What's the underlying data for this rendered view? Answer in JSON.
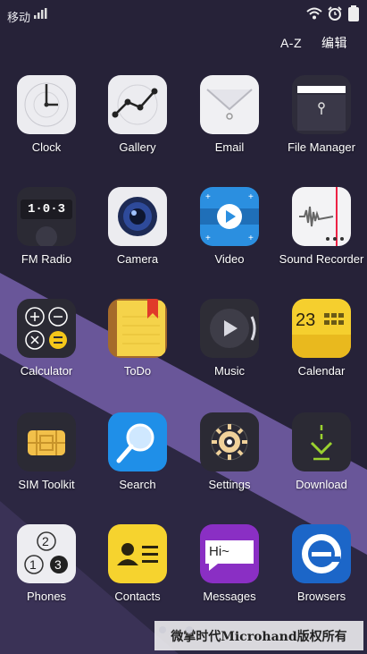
{
  "status_bar": {
    "carrier": "移动",
    "icons": [
      "wifi-icon",
      "alarm-icon",
      "battery-icon"
    ]
  },
  "top_actions": {
    "sort_label": "A-Z",
    "edit_label": "编辑"
  },
  "apps": [
    {
      "label": "Clock",
      "icon": "clock-icon"
    },
    {
      "label": "Gallery",
      "icon": "gallery-icon"
    },
    {
      "label": "Email",
      "icon": "email-icon"
    },
    {
      "label": "File Manager",
      "icon": "file-manager-icon"
    },
    {
      "label": "FM Radio",
      "icon": "fm-radio-icon",
      "display": "1·0·3"
    },
    {
      "label": "Camera",
      "icon": "camera-icon"
    },
    {
      "label": "Video",
      "icon": "video-icon"
    },
    {
      "label": "Sound Recorder",
      "icon": "sound-recorder-icon"
    },
    {
      "label": "Calculator",
      "icon": "calculator-icon"
    },
    {
      "label": "ToDo",
      "icon": "todo-icon"
    },
    {
      "label": "Music",
      "icon": "music-icon"
    },
    {
      "label": "Calendar",
      "icon": "calendar-icon",
      "display": "23"
    },
    {
      "label": "SIM Toolkit",
      "icon": "sim-toolkit-icon"
    },
    {
      "label": "Search",
      "icon": "search-icon"
    },
    {
      "label": "Settings",
      "icon": "settings-icon"
    },
    {
      "label": "Download",
      "icon": "download-icon"
    },
    {
      "label": "Phones",
      "icon": "phones-icon",
      "display": [
        "2",
        "1",
        "3"
      ]
    },
    {
      "label": "Contacts",
      "icon": "contacts-icon"
    },
    {
      "label": "Messages",
      "icon": "messages-icon",
      "display": "Hi~"
    },
    {
      "label": "Browsers",
      "icon": "browser-icon"
    }
  ],
  "pager": {
    "pages": 2,
    "current": 1
  },
  "watermark": "微掌时代Microhand版权所有",
  "colors": {
    "background": "#262238",
    "accent_stripe": "#6d5a9e"
  }
}
